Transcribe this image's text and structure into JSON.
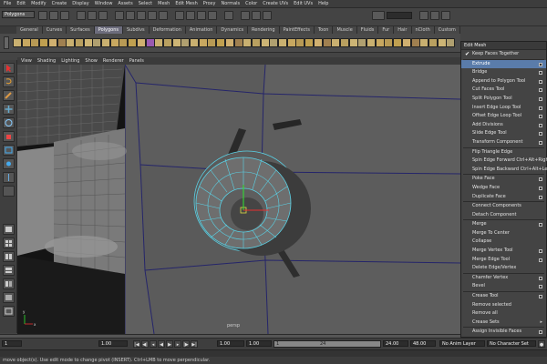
{
  "menubar": {
    "items": [
      "File",
      "Edit",
      "Modify",
      "Create",
      "Display",
      "Window",
      "Assets",
      "Select",
      "Mesh",
      "Edit Mesh",
      "Proxy",
      "Normals",
      "Color",
      "Create UVs",
      "Edit UVs",
      "Help"
    ]
  },
  "status_line": {
    "mode": "Polygons"
  },
  "shelf": {
    "tabs": [
      "General",
      "Curves",
      "Surfaces",
      "Polygons",
      "Subdivs",
      "Deformation",
      "Animation",
      "Dynamics",
      "Rendering",
      "PaintEffects",
      "Toon",
      "Muscle",
      "Fluids",
      "Fur",
      "Hair",
      "nCloth",
      "Custom"
    ],
    "active_tab": "Polygons"
  },
  "panel_menu": {
    "items": [
      "View",
      "Shading",
      "Lighting",
      "Show",
      "Renderer",
      "Panels"
    ]
  },
  "viewport": {
    "camera_label": "persp",
    "axis_y": "y",
    "axis_x": "x"
  },
  "edit_mesh_menu": {
    "title": "Edit Mesh",
    "items": [
      {
        "label": "Keep Faces Together",
        "checked": true
      },
      {
        "label": "Extrude",
        "option": true,
        "selected": true
      },
      {
        "label": "Bridge",
        "option": true
      },
      {
        "label": "Append to Polygon Tool",
        "option": true
      },
      {
        "label": "Cut Faces Tool",
        "option": true
      },
      {
        "label": "Split Polygon Tool",
        "option": true
      },
      {
        "label": "Insert Edge Loop Tool",
        "option": true
      },
      {
        "label": "Offset Edge Loop Tool",
        "option": true
      },
      {
        "label": "Add Divisions",
        "option": true
      },
      {
        "label": "Slide Edge Tool",
        "option": true
      },
      {
        "label": "Transform Component",
        "option": true
      },
      {
        "label": "Flip Triangle Edge"
      },
      {
        "label": "Spin Edge Forward  Ctrl+Alt+Right"
      },
      {
        "label": "Spin Edge Backward  Ctrl+Alt+Left"
      },
      {
        "label": "Poke Face",
        "option": true
      },
      {
        "label": "Wedge Face",
        "option": true
      },
      {
        "label": "Duplicate Face",
        "option": true
      },
      {
        "label": "Connect Components"
      },
      {
        "label": "Detach Component"
      },
      {
        "label": "Merge",
        "option": true
      },
      {
        "label": "Merge To Center"
      },
      {
        "label": "Collapse"
      },
      {
        "label": "Merge Vertex Tool",
        "option": true
      },
      {
        "label": "Merge Edge Tool",
        "option": true
      },
      {
        "label": "Delete Edge/Vertex"
      },
      {
        "label": "Chamfer Vertex",
        "option": true
      },
      {
        "label": "Bevel",
        "option": true
      },
      {
        "label": "Crease Tool",
        "option": true
      },
      {
        "label": "Remove selected"
      },
      {
        "label": "Remove all"
      },
      {
        "label": "Crease Sets",
        "submenu": true
      },
      {
        "label": "Assign Invisible Faces",
        "option": true
      }
    ],
    "separators_after": [
      0,
      10,
      13,
      16,
      18,
      24,
      26,
      30
    ]
  },
  "time_slider": {
    "current_frame": "1"
  },
  "range_slider": {
    "start_field": "1.00",
    "start_field2": "1.00",
    "range_start": "1.00",
    "range_start2": "1.00",
    "range_label": "1",
    "range_end_label": "24",
    "end_field": "24.00",
    "end_field2": "48.00",
    "anim_layer": "No Anim Layer",
    "char_set": "No Character Set"
  },
  "help_line": {
    "text": "move object(s). Use edit mode to change pivot (INSERT). Ctrl+LMB to move perpendicular."
  },
  "colors": {
    "selected_menu": "#5a7caa",
    "active_tab": "#6c6c7c",
    "wire_selected": "#5ad2e6",
    "edge_dark": "#1a1a5a"
  }
}
